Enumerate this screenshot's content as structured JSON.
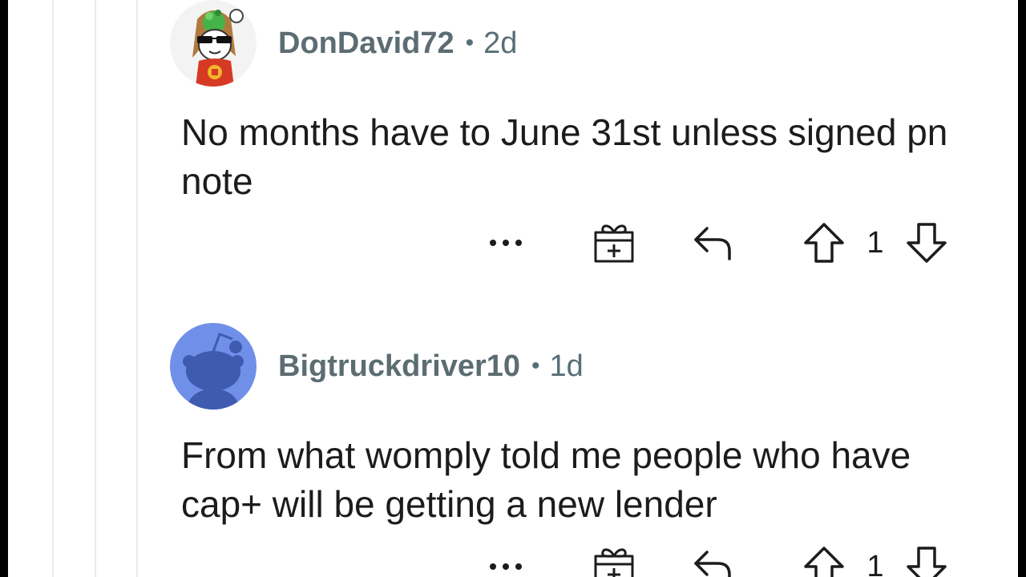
{
  "comments": [
    {
      "username": "DonDavid72",
      "separator": "•",
      "age": "2d",
      "text": "No months have to June 31st unless signed pn note",
      "more_label": "•••",
      "score": "1",
      "avatar_icon": "custom-avatar-character-icon"
    },
    {
      "username": "Bigtruckdriver10",
      "separator": "•",
      "age": "1d",
      "text": "From what womply told me people who have cap+ will be getting a new lender",
      "more_label": "•••",
      "score": "1",
      "avatar_icon": "default-snoo-avatar-icon",
      "avatar_color": "#6f8fe8"
    }
  ],
  "colors": {
    "text": "#1c1c1c",
    "meta": "#576f76",
    "icon": "#1c1c1c",
    "thread_line": "#e8eaed"
  }
}
